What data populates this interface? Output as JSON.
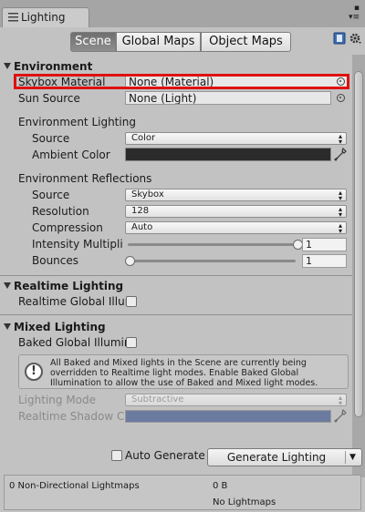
{
  "window": {
    "tab_title": "Lighting",
    "window_buttons": "▪\n▾≡"
  },
  "toolbar": {
    "tabs": [
      {
        "label": "Scene",
        "active": true
      },
      {
        "label": "Global Maps",
        "active": false
      },
      {
        "label": "Object Maps",
        "active": false
      }
    ],
    "help_icon": "help-book-icon",
    "settings_icon": "gear-icon"
  },
  "environment": {
    "header": "Environment",
    "skybox_material": {
      "label": "Skybox Material",
      "value": "None (Material)"
    },
    "sun_source": {
      "label": "Sun Source",
      "value": "None (Light)"
    },
    "lighting_header": "Environment Lighting",
    "source": {
      "label": "Source",
      "value": "Color"
    },
    "ambient_color": {
      "label": "Ambient Color",
      "color": "#2b2b2b"
    },
    "reflections_header": "Environment Reflections",
    "refl_source": {
      "label": "Source",
      "value": "Skybox"
    },
    "resolution": {
      "label": "Resolution",
      "value": "128"
    },
    "compression": {
      "label": "Compression",
      "value": "Auto"
    },
    "intensity": {
      "label": "Intensity Multiplie",
      "value": "1",
      "level": 1.0
    },
    "bounces": {
      "label": "Bounces",
      "value": "1",
      "level": 0.0
    }
  },
  "realtime": {
    "header": "Realtime Lighting",
    "gi_label": "Realtime Global Illur",
    "gi_checked": false
  },
  "mixed": {
    "header": "Mixed Lighting",
    "baked_label": "Baked Global Illumir",
    "baked_checked": false,
    "info": "All Baked and Mixed lights in the Scene are currently being overridden to Realtime light modes. Enable Baked Global Illumination to allow the use of Baked and Mixed light modes.",
    "lighting_mode": {
      "label": "Lighting Mode",
      "value": "Subtractive"
    },
    "shadow_color": {
      "label": "Realtime Shadow Co",
      "color": "#6b7ba0"
    }
  },
  "footer": {
    "auto_generate": "Auto Generate",
    "auto_checked": false,
    "generate_button": "Generate Lighting",
    "lightmaps_label": "0 Non-Directional Lightmaps",
    "size": "0 B",
    "status": "No Lightmaps"
  },
  "colors": {
    "highlight": "#e01010",
    "panel": "#c2c2c2"
  }
}
